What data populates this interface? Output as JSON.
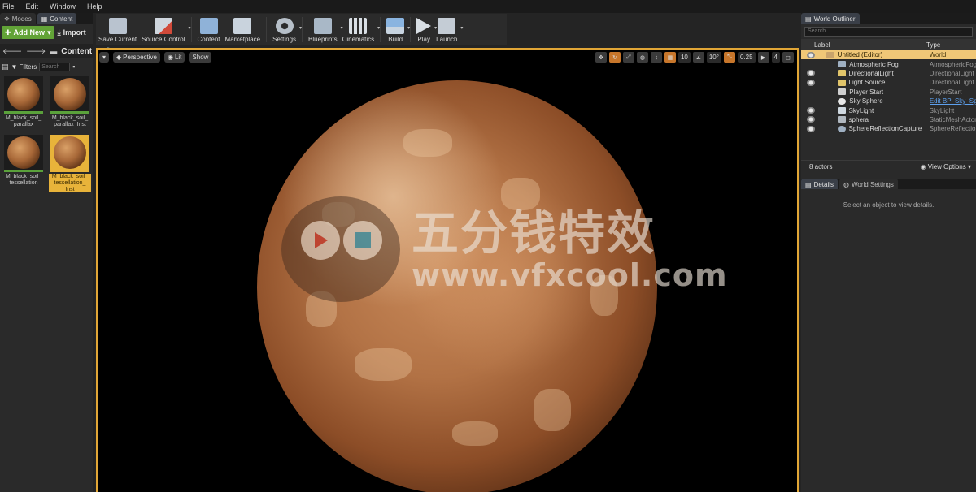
{
  "menu": [
    "File",
    "Edit",
    "Window",
    "Help"
  ],
  "left_tabs": {
    "modes": "Modes",
    "content": "Content"
  },
  "content_browser": {
    "add_new": "Add New",
    "import": "Import",
    "path": "Content",
    "filters": "Filters",
    "search_placeholder": "Search",
    "assets": [
      {
        "label": "M_black_soil_\nparallax"
      },
      {
        "label": "M_black_soil_\nparallax_Inst"
      },
      {
        "label": "M_black_soil_\ntessellation"
      },
      {
        "label": "M_black_soil_\ntessellation_\nInst"
      }
    ]
  },
  "toolbar": {
    "save_current": "Save Current",
    "source_control": "Source Control",
    "content": "Content",
    "marketplace": "Marketplace",
    "settings": "Settings",
    "blueprints": "Blueprints",
    "cinematics": "Cinematics",
    "build": "Build",
    "play": "Play",
    "launch": "Launch"
  },
  "viewport": {
    "perspective": "Perspective",
    "lit": "Lit",
    "show": "Show",
    "grid_snap": "10",
    "rot_snap": "10°",
    "scale_snap": "0.25",
    "cam_speed": "4"
  },
  "watermark": {
    "cn": "五分钱特效",
    "url": "www.vfxcool.com"
  },
  "outliner": {
    "tab": "World Outliner",
    "search_placeholder": "Search...",
    "col_label": "Label",
    "col_type": "Type",
    "rows": [
      {
        "name": "Untitled (Editor)",
        "type": "World"
      },
      {
        "name": "Atmospheric Fog",
        "type": "AtmosphericFog"
      },
      {
        "name": "DirectionalLight",
        "type": "DirectionalLight"
      },
      {
        "name": "Light Source",
        "type": "DirectionalLight"
      },
      {
        "name": "Player Start",
        "type": "PlayerStart"
      },
      {
        "name": "Sky Sphere",
        "type": "Edit BP_Sky_Sp"
      },
      {
        "name": "SkyLight",
        "type": "SkyLight"
      },
      {
        "name": "sphera",
        "type": "StaticMeshActor"
      },
      {
        "name": "SphereReflectionCapture",
        "type": "SphereReflection"
      }
    ],
    "actor_count": "8 actors",
    "view_options": "View Options"
  },
  "details": {
    "tab_details": "Details",
    "tab_world_settings": "World Settings",
    "hint": "Select an object to view details."
  }
}
